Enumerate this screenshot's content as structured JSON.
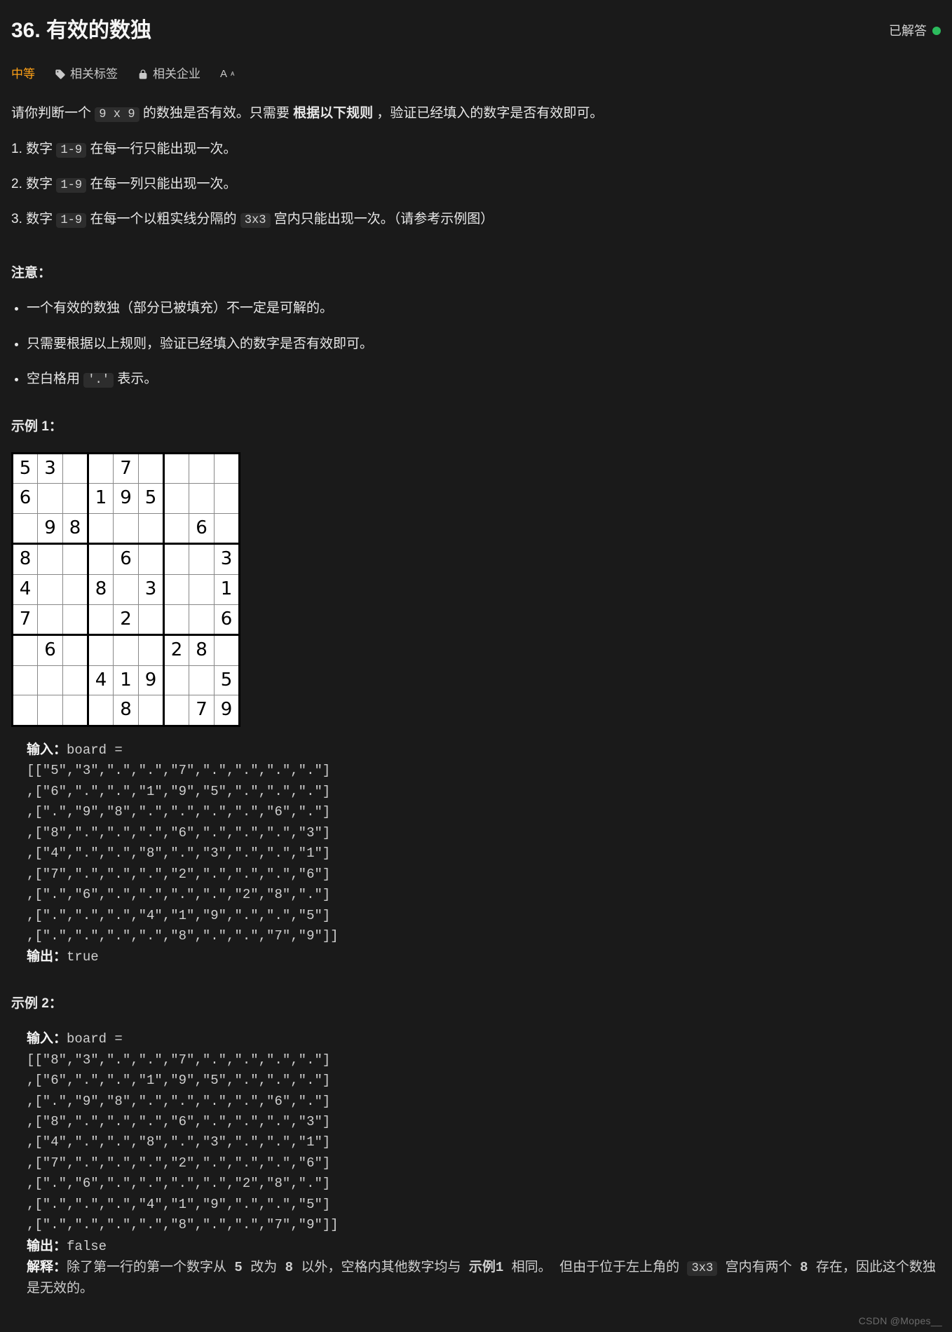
{
  "header": {
    "title": "36. 有效的数独",
    "status_label": "已解答"
  },
  "tabs": {
    "difficulty": "中等",
    "tags": "相关标签",
    "companies": "相关企业",
    "aa": "A"
  },
  "intro": {
    "pre": "请你判断一个 ",
    "code1": "9 x 9",
    "mid": " 的数独是否有效。只需要 ",
    "bold": "根据以下规则",
    "tail": " ，验证已经填入的数字是否有效即可。"
  },
  "rules": [
    {
      "pre": "1. 数字 ",
      "code": "1-9",
      "post": " 在每一行只能出现一次。"
    },
    {
      "pre": "2. 数字 ",
      "code": "1-9",
      "post": " 在每一列只能出现一次。"
    },
    {
      "pre": "3. 数字 ",
      "code": "1-9",
      "mid": " 在每一个以粗实线分隔的 ",
      "code2": "3x3",
      "post": " 宫内只能出现一次。（请参考示例图）"
    }
  ],
  "notice": {
    "heading": "注意：",
    "items": [
      "一个有效的数独（部分已被填充）不一定是可解的。",
      "只需要根据以上规则，验证已经填入的数字是否有效即可。",
      {
        "pre": "空白格用 ",
        "code": "'.'",
        "post": " 表示。"
      }
    ]
  },
  "examples": {
    "ex1_heading": "示例 1：",
    "ex2_heading": "示例 2：",
    "input_label": "输入：",
    "output_label": "输出：",
    "explain_label": "解释：",
    "ex1_input": "board = \n[[\"5\",\"3\",\".\",\".\",\"7\",\".\",\".\",\".\",\".\"]\n,[\"6\",\".\",\".\",\"1\",\"9\",\"5\",\".\",\".\",\".\"]\n,[\".\",\"9\",\"8\",\".\",\".\",\".\",\".\",\"6\",\".\"]\n,[\"8\",\".\",\".\",\".\",\"6\",\".\",\".\",\".\",\"3\"]\n,[\"4\",\".\",\".\",\"8\",\".\",\"3\",\".\",\".\",\"1\"]\n,[\"7\",\".\",\".\",\".\",\"2\",\".\",\".\",\".\",\"6\"]\n,[\".\",\"6\",\".\",\".\",\".\",\".\",\"2\",\"8\",\".\"]\n,[\".\",\".\",\".\",\"4\",\"1\",\"9\",\".\",\".\",\"5\"]\n,[\".\",\".\",\".\",\".\",\"8\",\".\",\".\",\"7\",\"9\"]]",
    "ex1_output": "true",
    "ex2_input": "board = \n[[\"8\",\"3\",\".\",\".\",\"7\",\".\",\".\",\".\",\".\"]\n,[\"6\",\".\",\".\",\"1\",\"9\",\"5\",\".\",\".\",\".\"]\n,[\".\",\"9\",\"8\",\".\",\".\",\".\",\".\",\"6\",\".\"]\n,[\"8\",\".\",\".\",\".\",\"6\",\".\",\".\",\".\",\"3\"]\n,[\"4\",\".\",\".\",\"8\",\".\",\"3\",\".\",\".\",\"1\"]\n,[\"7\",\".\",\".\",\".\",\"2\",\".\",\".\",\".\",\"6\"]\n,[\".\",\"6\",\".\",\".\",\".\",\".\",\"2\",\"8\",\".\"]\n,[\".\",\".\",\".\",\"4\",\"1\",\"9\",\".\",\".\",\"5\"]\n,[\".\",\".\",\".\",\".\",\"8\",\".\",\".\",\"7\",\"9\"]]",
    "ex2_output": "false",
    "ex2_explain": {
      "pre": "除了第一行的第一个数字从 ",
      "b1": "5",
      "mid1": " 改为 ",
      "b2": "8",
      "mid2": " 以外，空格内其他数字均与 ",
      "b3": "示例1",
      "mid3": " 相同。 但由于位于左上角的 ",
      "code": "3x3",
      "mid4": " 宫内有两个 ",
      "b4": "8",
      "tail": " 存在，因此这个数独是无效的。"
    }
  },
  "sudoku": [
    [
      "5",
      "3",
      "",
      "",
      "7",
      "",
      "",
      "",
      ""
    ],
    [
      "6",
      "",
      "",
      "1",
      "9",
      "5",
      "",
      "",
      ""
    ],
    [
      "",
      "9",
      "8",
      "",
      "",
      "",
      "",
      "6",
      ""
    ],
    [
      "8",
      "",
      "",
      "",
      "6",
      "",
      "",
      "",
      "3"
    ],
    [
      "4",
      "",
      "",
      "8",
      "",
      "3",
      "",
      "",
      "1"
    ],
    [
      "7",
      "",
      "",
      "",
      "2",
      "",
      "",
      "",
      "6"
    ],
    [
      "",
      "6",
      "",
      "",
      "",
      "",
      "2",
      "8",
      ""
    ],
    [
      "",
      "",
      "",
      "4",
      "1",
      "9",
      "",
      "",
      "5"
    ],
    [
      "",
      "",
      "",
      "",
      "8",
      "",
      "",
      "7",
      "9"
    ]
  ],
  "watermark": "CSDN @Mopes__"
}
